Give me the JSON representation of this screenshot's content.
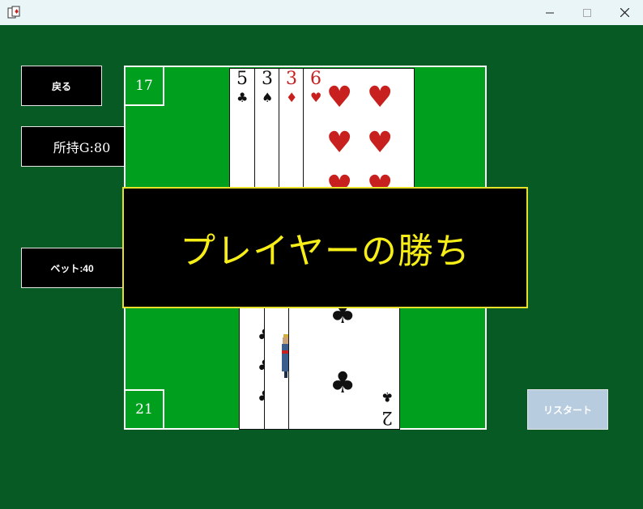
{
  "window": {
    "icon": "cards-app-icon"
  },
  "buttons": {
    "back": "戻る",
    "gold": "所持G:80",
    "bet": "ベット:40",
    "restart": "リスタート"
  },
  "scores": {
    "dealer": "17",
    "player": "21"
  },
  "dealer_cards": [
    {
      "rank": "5",
      "suit": "♣"
    },
    {
      "rank": "3",
      "suit": "♠"
    },
    {
      "rank": "3",
      "suit": "♦"
    },
    {
      "rank": "6",
      "suit": "♥"
    }
  ],
  "player_cards": [
    {
      "suit": "♣"
    },
    {
      "suit": "♣"
    },
    {
      "rank": "2",
      "suit": "♣"
    }
  ],
  "result": "プレイヤーの勝ち",
  "colors": {
    "felt": "#075a23",
    "table": "#00a01e",
    "result_text": "#f7ee18",
    "restart_bg": "#b8cce0"
  }
}
